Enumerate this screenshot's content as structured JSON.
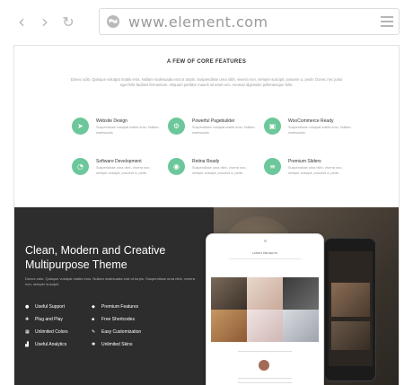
{
  "browser": {
    "url": "www.element.com",
    "back_icon": "chevron-left-icon",
    "forward_icon": "chevron-right-icon",
    "reload_icon": "reload-icon",
    "site_icon": "globe-icon",
    "menu_icon": "hamburger-menu-icon"
  },
  "features": {
    "title": "A FEW OF CORE FEATURES",
    "description": "Donec odio. Quisque volutpat mattis eros. Nullam malesuada erat ut turpis. Suspendisse urna nibh, viverra non, semper suscipit, posuere a, pede. Donec nec justo eget felis facilisis fermentum. Aliquam porttitor mauris sit amet orci. Aenean dignissim pellentesque felis.",
    "accent_color": "#6cc79a",
    "items": [
      {
        "title": "Website Design",
        "desc": "Suspendisse volutpat mattis eros. Nullam malesuada",
        "icon": "paper-plane-icon"
      },
      {
        "title": "Powerful Pagebuilder",
        "desc": "Suspendisse volutpat mattis eros. Nullam malesuada",
        "icon": "gears-icon"
      },
      {
        "title": "WooCommerce Ready",
        "desc": "Suspendisse volutpat mattis eros. Nullam malesuada",
        "icon": "cart-icon"
      },
      {
        "title": "Software Development",
        "desc": "Suspendisse urna nibh, viverra non, semper suscipit, posuere a, pede.",
        "icon": "dashboard-icon"
      },
      {
        "title": "Retina Ready",
        "desc": "Suspendisse urna nibh, viverra non, semper suscipit, posuere a, pede.",
        "icon": "eye-icon"
      },
      {
        "title": "Premium Sliders",
        "desc": "Suspendisse urna nibh, viverra non, semper suscipit, posuere a, pede.",
        "icon": "sliders-icon"
      }
    ]
  },
  "hero": {
    "headline_line1": "Clean, Modern and Creative",
    "headline_line2": "Multipurpose Theme",
    "description": "Donec odio. Quisque volutpat mattis eros. Nullam malesuada erat ut turpis. Suspendisse urna nibh, viverra non, semper suscipit.",
    "items": [
      {
        "label": "Useful Support",
        "icon": "support-icon"
      },
      {
        "label": "Premium Features",
        "icon": "diamond-icon"
      },
      {
        "label": "Plug and Play",
        "icon": "plug-icon"
      },
      {
        "label": "Free Shortcodes",
        "icon": "code-icon"
      },
      {
        "label": "Unlimited Colors",
        "icon": "palette-icon"
      },
      {
        "label": "Easy Customization",
        "icon": "wrench-icon"
      },
      {
        "label": "Useful Analytics",
        "icon": "chart-icon"
      },
      {
        "label": "Unlimited Skins",
        "icon": "skins-icon"
      }
    ]
  },
  "mockup": {
    "tablet_heading": "LATEST PROJECTS"
  }
}
